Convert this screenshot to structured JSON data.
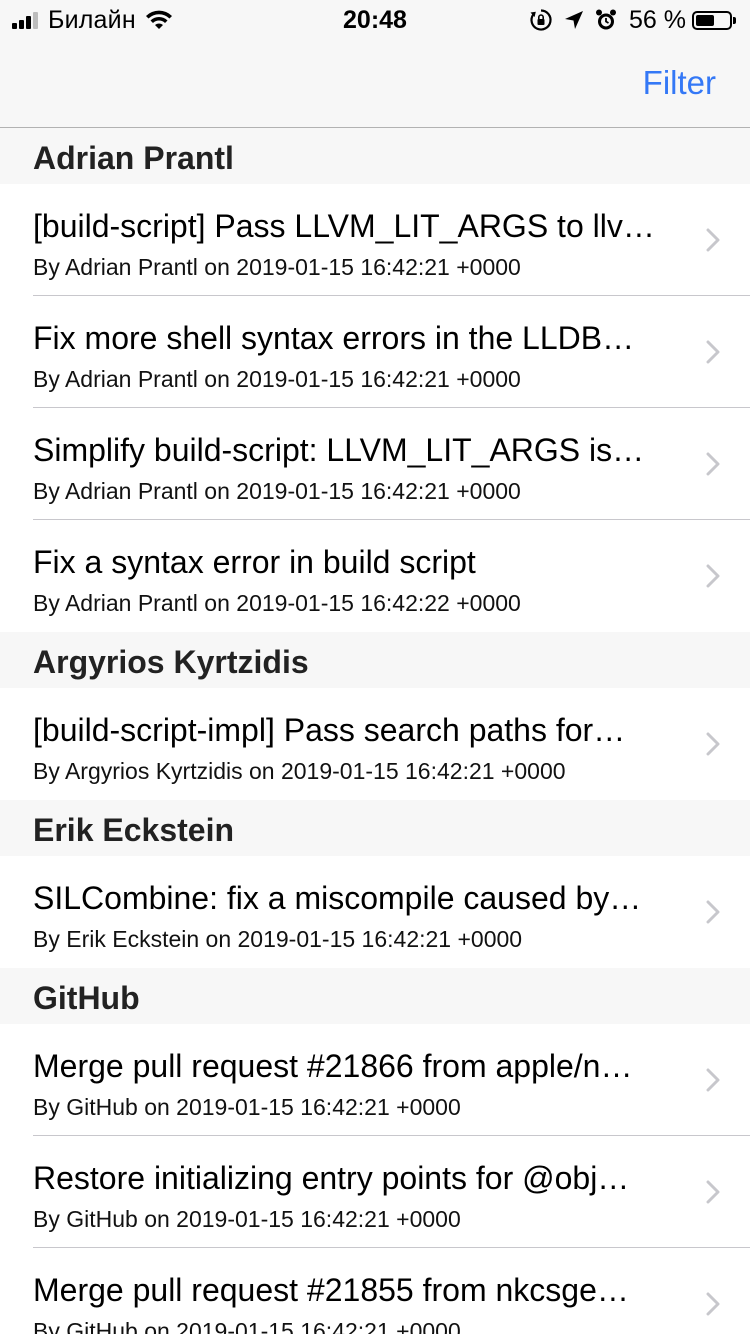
{
  "status_bar": {
    "carrier": "Билайн",
    "time": "20:48",
    "battery_percent": "56 %",
    "battery_level": 0.56,
    "icons": [
      "signal-icon",
      "wifi-icon",
      "orientation-lock-icon",
      "location-arrow-icon",
      "alarm-icon",
      "battery-icon"
    ]
  },
  "nav": {
    "filter_label": "Filter",
    "accent_color": "#3478f6"
  },
  "sections": [
    {
      "title": "Adrian Prantl",
      "rows": [
        {
          "title": "[build-script] Pass LLVM_LIT_ARGS to llv…",
          "subtitle": "By Adrian Prantl on 2019-01-15 16:42:21 +0000"
        },
        {
          "title": "Fix more shell syntax errors in the LLDB…",
          "subtitle": "By Adrian Prantl on 2019-01-15 16:42:21 +0000"
        },
        {
          "title": "Simplify build-script: LLVM_LIT_ARGS is…",
          "subtitle": "By Adrian Prantl on 2019-01-15 16:42:21 +0000"
        },
        {
          "title": "Fix a syntax error in build script",
          "subtitle": "By Adrian Prantl on 2019-01-15 16:42:22 +0000"
        }
      ]
    },
    {
      "title": "Argyrios Kyrtzidis",
      "rows": [
        {
          "title": "[build-script-impl] Pass search paths for…",
          "subtitle": "By Argyrios Kyrtzidis on 2019-01-15 16:42:21 +0000"
        }
      ]
    },
    {
      "title": "Erik Eckstein",
      "rows": [
        {
          "title": "SILCombine: fix a miscompile caused by…",
          "subtitle": "By Erik Eckstein on 2019-01-15 16:42:21 +0000"
        }
      ]
    },
    {
      "title": "GitHub",
      "rows": [
        {
          "title": "Merge pull request #21866 from apple/n…",
          "subtitle": "By GitHub on 2019-01-15 16:42:21 +0000"
        },
        {
          "title": "Restore initializing entry points for @obj…",
          "subtitle": "By GitHub on 2019-01-15 16:42:21 +0000"
        },
        {
          "title": "Merge pull request #21855 from nkcsge…",
          "subtitle": "By GitHub on 2019-01-15 16:42:21 +0000"
        }
      ]
    }
  ]
}
